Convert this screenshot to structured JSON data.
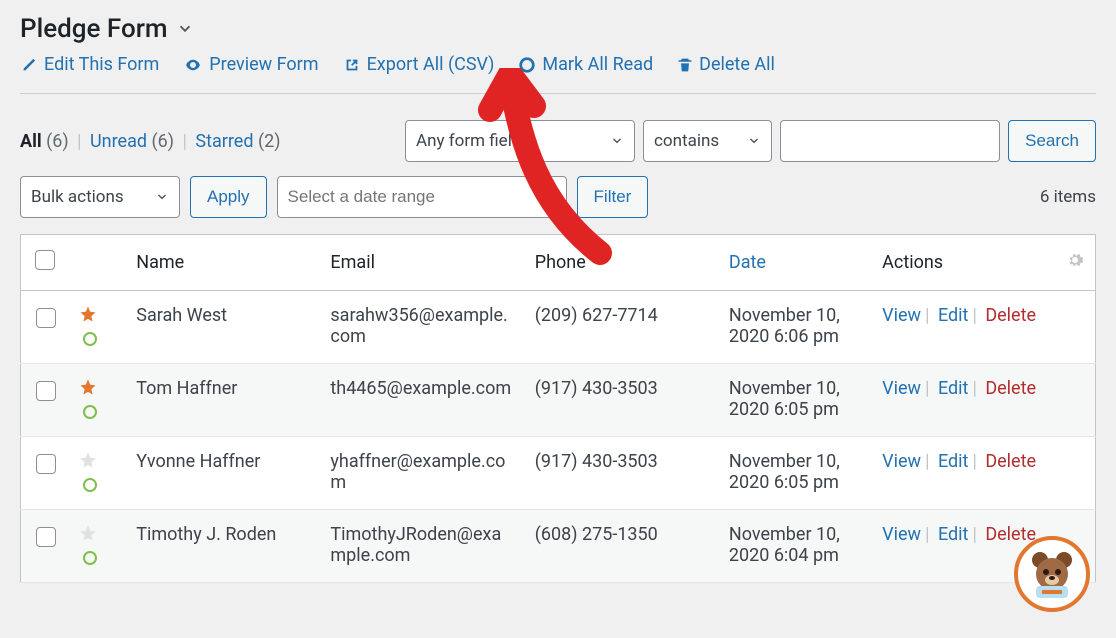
{
  "page": {
    "title": "Pledge Form"
  },
  "toolbar": {
    "edit": "Edit This Form",
    "preview": "Preview Form",
    "export": "Export All (CSV)",
    "mark_read": "Mark All Read",
    "delete_all": "Delete All"
  },
  "status": {
    "all_label": "All",
    "all_count": "(6)",
    "unread_label": "Unread",
    "unread_count": "(6)",
    "starred_label": "Starred",
    "starred_count": "(2)"
  },
  "filters": {
    "any_field": "Any form field",
    "condition": "contains",
    "search_value": "",
    "search_btn": "Search",
    "bulk_actions": "Bulk actions",
    "apply_btn": "Apply",
    "date_range_placeholder": "Select a date range",
    "filter_btn": "Filter",
    "items_count": "6 items"
  },
  "columns": {
    "name": "Name",
    "email": "Email",
    "phone": "Phone",
    "date": "Date",
    "actions": "Actions"
  },
  "actions": {
    "view": "View",
    "edit": "Edit",
    "delete": "Delete"
  },
  "rows": [
    {
      "starred": true,
      "name": "Sarah West",
      "email": "sarahw356@example.com",
      "phone": "(209) 627-7714",
      "date": "November 10, 2020 6:06 pm"
    },
    {
      "starred": true,
      "name": "Tom Haffner",
      "email": "th4465@example.com",
      "phone": "(917) 430-3503",
      "date": "November 10, 2020 6:05 pm"
    },
    {
      "starred": false,
      "name": "Yvonne Haffner",
      "email": "yhaffner@example.com",
      "phone": "(917) 430-3503",
      "date": "November 10, 2020 6:05 pm"
    },
    {
      "starred": false,
      "name": "Timothy J. Roden",
      "email": "TimothyJRoden@example.com",
      "phone": "(608) 275-1350",
      "date": "November 10, 2020 6:04 pm"
    }
  ]
}
